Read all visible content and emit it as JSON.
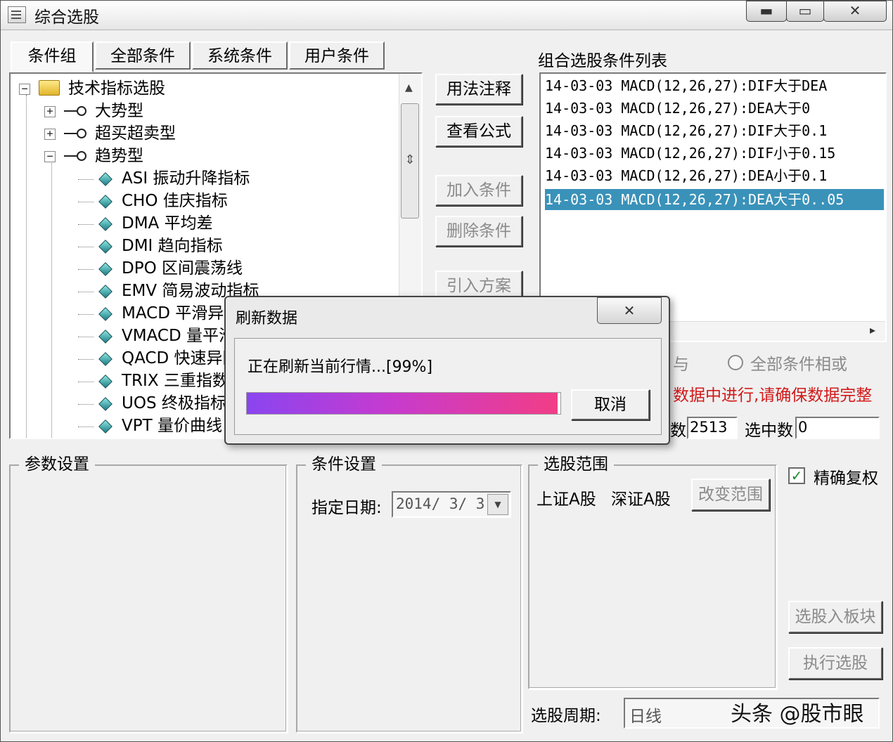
{
  "window": {
    "title": "综合选股",
    "min_glyph": "▬",
    "max_glyph": "▭",
    "close_glyph": "✕"
  },
  "tabs": [
    {
      "label": "条件组",
      "active": true
    },
    {
      "label": "全部条件"
    },
    {
      "label": "系统条件"
    },
    {
      "label": "用户条件"
    }
  ],
  "tree": {
    "root": "技术指标选股",
    "groups": [
      "大势型",
      "超买超卖型",
      "趋势型"
    ],
    "items": [
      "ASI 振动升降指标",
      "CHO 佳庆指标",
      "DMA 平均差",
      "DMI 趋向指标",
      "DPO 区间震荡线",
      "EMV 简易波动指标",
      "MACD 平滑异同",
      "VMACD 量平滑",
      "QACD 快速异同",
      "TRIX 三重指数",
      "UOS 终极指标",
      "VPT 量价曲线"
    ],
    "scroll_up": "▲",
    "scroll_thumb": "⇕"
  },
  "middle_buttons": {
    "usage_notes": "用法注释",
    "view_formula": "查看公式",
    "add_condition": "加入条件",
    "delete_condition": "删除条件",
    "import_plan": "引入方案"
  },
  "condition_list": {
    "title": "组合选股条件列表",
    "rows": [
      "14-03-03 MACD(12,26,27):DIF大于DEA",
      "14-03-03 MACD(12,26,27):DEA大于0",
      "14-03-03 MACD(12,26,27):DIF大于0.1",
      "14-03-03 MACD(12,26,27):DIF小于0.15",
      "14-03-03 MACD(12,26,27):DEA小于0.1",
      "14-03-03 MACD(12,26,27):DEA大于0..05"
    ],
    "selected_index": 5,
    "scroll_right": "▸"
  },
  "logic": {
    "and_label_partial": "与",
    "or_label": "全部条件相或"
  },
  "warning_partial": "数据中进行,请确保数据完整",
  "stats": {
    "total_label_partial": "数",
    "total_value": "2513",
    "selected_label": "选中数",
    "selected_value": "0"
  },
  "param_group": {
    "title": "参数设置"
  },
  "condition_group": {
    "title": "条件设置",
    "date_label": "指定日期:",
    "date_value": "2014/ 3/ 3",
    "dropdown_glyph": "▼"
  },
  "range_group": {
    "title": "选股范围",
    "markets": [
      "上证A股",
      "深证A股"
    ],
    "change_button": "改变范围"
  },
  "precise_rights": {
    "label": "精确复权",
    "checked": true,
    "check_glyph": "✓"
  },
  "side_buttons": {
    "to_block": "选股入板块",
    "execute": "执行选股"
  },
  "period": {
    "label": "选股周期:",
    "value": "日线"
  },
  "watermark": "头条 @股市眼",
  "dialog": {
    "title": "刷新数据",
    "message": "正在刷新当前行情...[99%]",
    "progress": 0.99,
    "cancel": "取消",
    "close_glyph": "✕"
  }
}
